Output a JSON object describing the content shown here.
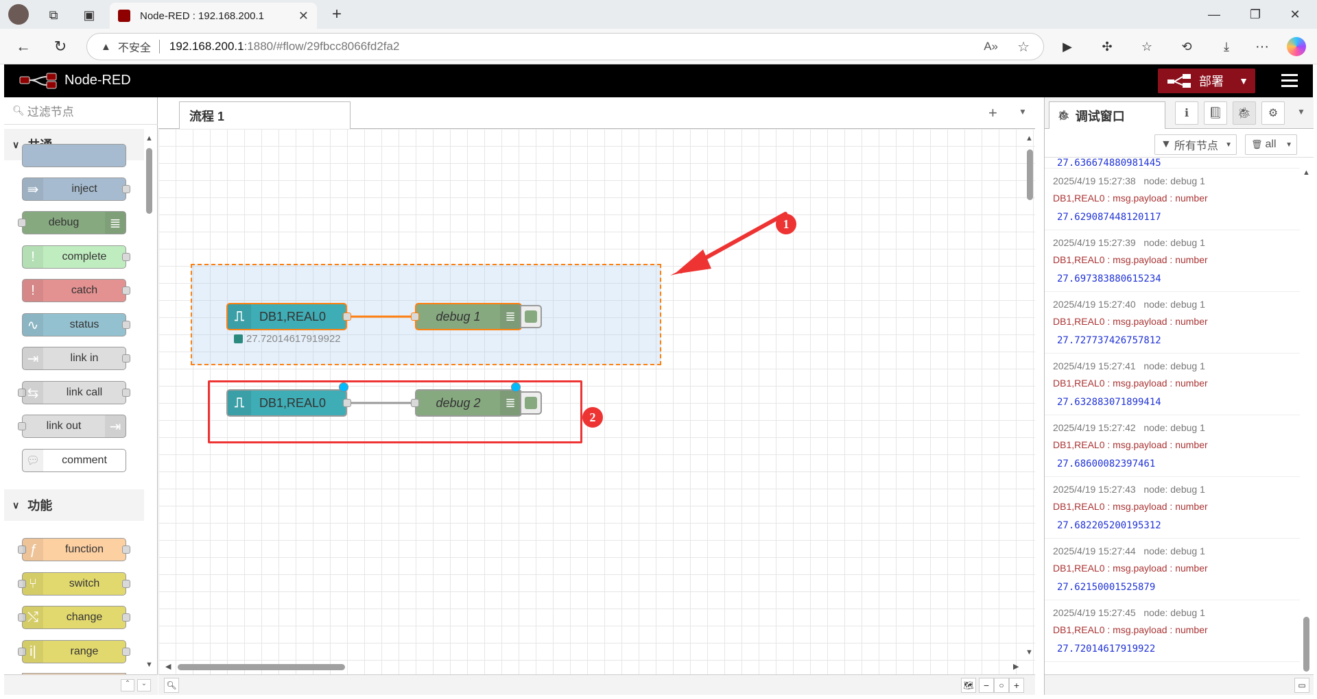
{
  "browser": {
    "tab_title": "Node-RED : 192.168.200.1",
    "security_label": "不安全",
    "url_host": "192.168.200.1",
    "url_rest": ":1880/#flow/29fbcc8066fd2fa2"
  },
  "header": {
    "app_name": "Node-RED",
    "deploy_label": "部署"
  },
  "palette": {
    "search_placeholder": "过滤节点",
    "categories": [
      {
        "label": "共通",
        "nodes": [
          {
            "label": "inject",
            "color": "#a6bbcf"
          },
          {
            "label": "debug",
            "color": "#87a980"
          },
          {
            "label": "complete",
            "color": "#c0edc0"
          },
          {
            "label": "catch",
            "color": "#e49191"
          },
          {
            "label": "status",
            "color": "#94c1d0"
          },
          {
            "label": "link in",
            "color": "#dddddd"
          },
          {
            "label": "link call",
            "color": "#dddddd"
          },
          {
            "label": "link out",
            "color": "#dddddd"
          },
          {
            "label": "comment",
            "color": "#ffffff"
          }
        ]
      },
      {
        "label": "功能",
        "nodes": [
          {
            "label": "function",
            "color": "#fdd0a2"
          },
          {
            "label": "switch",
            "color": "#e2d96e"
          },
          {
            "label": "change",
            "color": "#e2d96e"
          },
          {
            "label": "range",
            "color": "#e2d96e"
          }
        ]
      }
    ]
  },
  "workspace": {
    "flow_tab": "流程 1",
    "nodes": {
      "s7_in_1": "DB1,REAL0",
      "s7_in_1_status": "27.72014617919922",
      "debug_1": "debug 1",
      "s7_in_2": "DB1,REAL0",
      "debug_2": "debug 2"
    },
    "annotations": [
      "1",
      "2"
    ]
  },
  "sidebar": {
    "tab_label": "调试窗口",
    "filter_label": "所有节点",
    "clear_label": "all",
    "partial_value": "27.636674880981445",
    "messages": [
      {
        "time": "2025/4/19 15:27:38",
        "node": "node: debug 1",
        "path": "DB1,REAL0 : msg.payload : number",
        "value": "27.629087448120117"
      },
      {
        "time": "2025/4/19 15:27:39",
        "node": "node: debug 1",
        "path": "DB1,REAL0 : msg.payload : number",
        "value": "27.697383880615234"
      },
      {
        "time": "2025/4/19 15:27:40",
        "node": "node: debug 1",
        "path": "DB1,REAL0 : msg.payload : number",
        "value": "27.727737426757812"
      },
      {
        "time": "2025/4/19 15:27:41",
        "node": "node: debug 1",
        "path": "DB1,REAL0 : msg.payload : number",
        "value": "27.632883071899414"
      },
      {
        "time": "2025/4/19 15:27:42",
        "node": "node: debug 1",
        "path": "DB1,REAL0 : msg.payload : number",
        "value": "27.68600082397461"
      },
      {
        "time": "2025/4/19 15:27:43",
        "node": "node: debug 1",
        "path": "DB1,REAL0 : msg.payload : number",
        "value": "27.682205200195312"
      },
      {
        "time": "2025/4/19 15:27:44",
        "node": "node: debug 1",
        "path": "DB1,REAL0 : msg.payload : number",
        "value": "27.62150001525879"
      },
      {
        "time": "2025/4/19 15:27:45",
        "node": "node: debug 1",
        "path": "DB1,REAL0 : msg.payload : number",
        "value": "27.72014617919922"
      }
    ]
  },
  "colors": {
    "deploy": "#8c101c",
    "s7_node": "#3fadb5",
    "debug_node": "#87a980",
    "selection": "#ff7f0e",
    "annotation_red": "#ee3333"
  }
}
